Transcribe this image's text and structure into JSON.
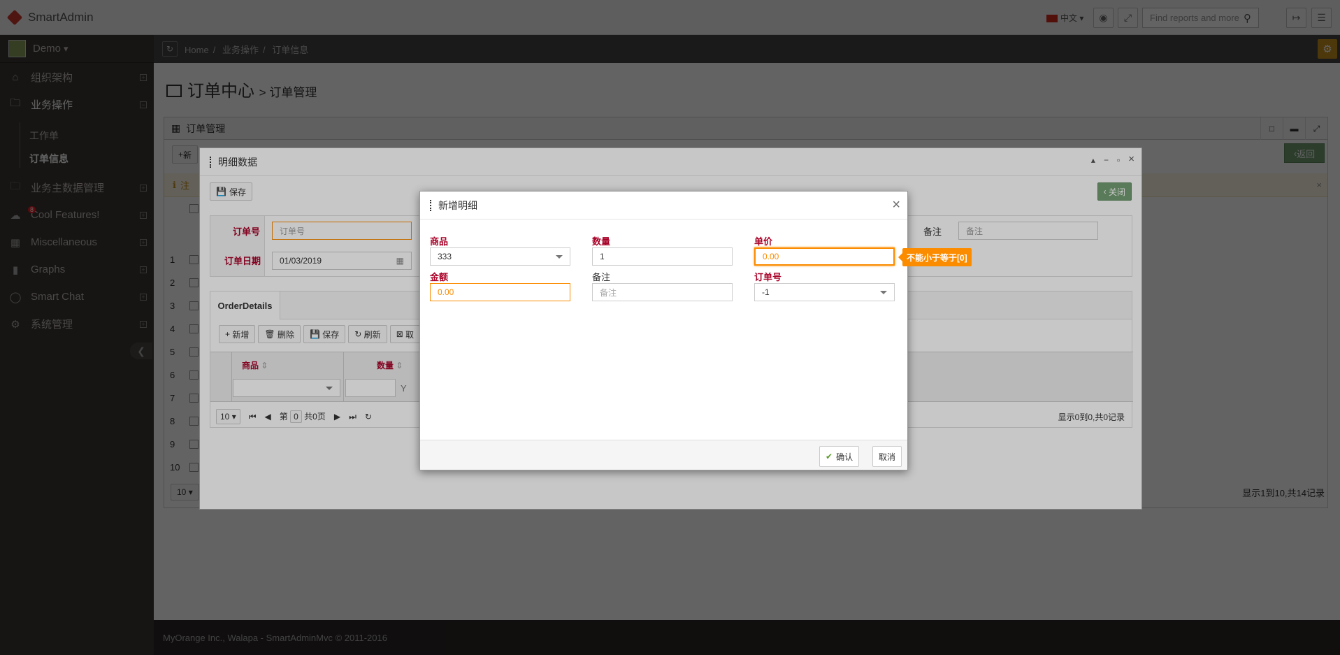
{
  "app": {
    "brand": "SmartAdmin"
  },
  "header": {
    "language": "中文",
    "search_placeholder": "Find reports and more"
  },
  "user": {
    "name": "Demo"
  },
  "sidebar": {
    "items": [
      {
        "label": "组织架构",
        "icon": "home-icon"
      },
      {
        "label": "业务操作",
        "icon": "folder-icon"
      },
      {
        "label": "业务主数据管理",
        "icon": "folder-icon"
      },
      {
        "label": "Cool Features!",
        "icon": "cloud-icon",
        "badge": "8"
      },
      {
        "label": "Miscellaneous",
        "icon": "windows-icon"
      },
      {
        "label": "Graphs",
        "icon": "bar-chart-icon"
      },
      {
        "label": "Smart Chat",
        "icon": "comment-icon"
      },
      {
        "label": "系统管理",
        "icon": "gears-icon"
      }
    ],
    "subitems": [
      "工作单",
      "订单信息"
    ]
  },
  "breadcrumb": [
    "Home",
    "业务操作",
    "订单信息"
  ],
  "page": {
    "title": "订单中心",
    "subtitle": "> 订单管理",
    "widget_title": "订单管理",
    "back_label": "返回",
    "add_label": "新",
    "alert_text": "注",
    "row_numbers": [
      "1",
      "2",
      "3",
      "4",
      "5",
      "6",
      "7",
      "8",
      "9",
      "10"
    ],
    "page_size": "10",
    "records_info": "显示1到10,共14记录"
  },
  "detail_modal": {
    "title": "明细数据",
    "save_label": "保存",
    "close_label": "关闭",
    "order_no_label": "订单号",
    "order_no_placeholder": "订单号",
    "order_date_label": "订单日期",
    "order_date_value": "01/03/2019",
    "remark_label": "备注",
    "remark_placeholder": "备注",
    "tab_label": "OrderDetails",
    "toolbar": [
      "新增",
      "删除",
      "保存",
      "刷新",
      "取"
    ],
    "col_product": "商品",
    "col_qty": "数量",
    "page_size": "10",
    "page_prefix": "第",
    "page_value": "0",
    "page_suffix": "共0页",
    "records_info": "显示0到0,共0记录"
  },
  "add_modal": {
    "title": "新增明细",
    "product_label": "商品",
    "product_value": "333",
    "qty_label": "数量",
    "qty_value": "1",
    "price_label": "单价",
    "price_value": "0.00",
    "amount_label": "金额",
    "amount_value": "0.00",
    "remark_label": "备注",
    "remark_placeholder": "备注",
    "order_no_label": "订单号",
    "order_no_value": "-1",
    "tooltip": "不能小于等于[0]",
    "confirm_label": "确认",
    "cancel_label": "取消"
  },
  "footer": {
    "text": "MyOrange Inc., Walapa - SmartAdminMvc © 2011-2016"
  },
  "colors": {
    "accent_orange": "#fb8c00",
    "label_red": "#a90329",
    "sidebar_bg": "#3a3633",
    "success_green": "#739e73"
  }
}
